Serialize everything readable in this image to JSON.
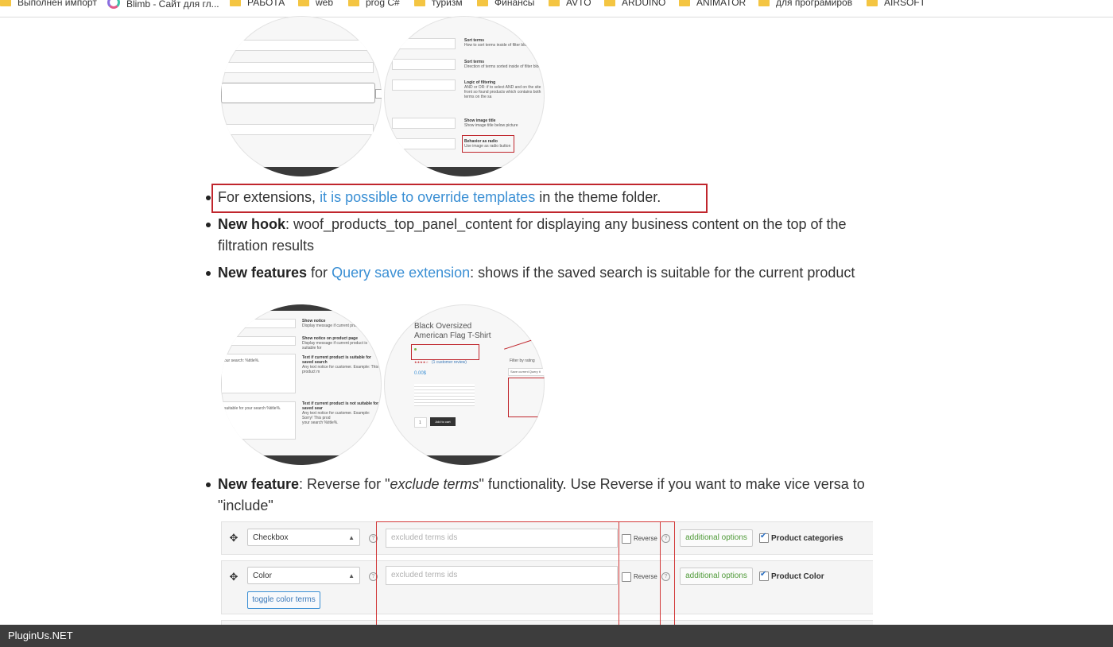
{
  "bookmarks": [
    {
      "label": "Выполнен импорт",
      "icon": "folder-icon"
    },
    {
      "label": "Blimb - Сайт для гл...",
      "icon": "blimb-logo-icon"
    },
    {
      "label": "РАБОТА",
      "icon": "folder-icon"
    },
    {
      "label": "web",
      "icon": "folder-icon"
    },
    {
      "label": "prog C#",
      "icon": "folder-icon"
    },
    {
      "label": "туризм",
      "icon": "folder-icon"
    },
    {
      "label": "Финансы",
      "icon": "folder-icon"
    },
    {
      "label": "AVTO",
      "icon": "folder-icon"
    },
    {
      "label": "ARDUINO",
      "icon": "folder-icon"
    },
    {
      "label": "ANIMATOR",
      "icon": "folder-icon"
    },
    {
      "label": "для програмиров",
      "icon": "folder-icon"
    },
    {
      "label": "AIRSOFT",
      "icon": "folder-icon"
    }
  ],
  "screenshot1": {
    "right": {
      "sort_terms_title": "Sort terms",
      "sort_terms_desc": "How to sort terms inside of filter block",
      "sort_terms2_title": "Sort terms",
      "sort_terms2_desc": "Direction of terms sorted inside of filter block",
      "logic_title": "Logic of filtering",
      "logic_desc": "AND or OR: if to select AND and on the site front so found products which contains both terms on the sa",
      "show_image_title": "Show image title",
      "show_image_desc": "Show image title below picture",
      "behavior_title": "Behavior as radio",
      "behavior_desc": "Use image as radio button"
    }
  },
  "list": {
    "item1": {
      "prefix": "For extensions, ",
      "link": "it is possible to override templates",
      "suffix": " in the theme folder."
    },
    "item2": {
      "bold": "New hook",
      "text": ": woof_products_top_panel_content for displaying any business content on the top of the filtration results"
    },
    "item3": {
      "bold": "New features",
      "mid": " for ",
      "link": "Query save extension",
      "text": ": shows if the saved search is suitable for the current product"
    },
    "item4": {
      "bold": "New feature",
      "text1": ": Reverse for \"",
      "italic": "exclude terms",
      "text2": "\" functionality. Use Reverse if you want to make vice versa to \"include\""
    }
  },
  "screenshot2": {
    "left": {
      "show_notice": "Show notice",
      "show_notice_desc": "Display message if current product is",
      "show_notice_page": "Show notice on product page",
      "show_notice_page_desc": "Display message if current product is suitable for",
      "text_suitable": "Text if current product is suitable for saved search",
      "text_suitable_desc": "Any text notice for customer. Example: This product m",
      "search_hint_1": "our search: %title%.",
      "text_not_suitable": "Text if current product is not suitable for saved sear",
      "text_not_suitable_desc": "Any text notice for customer. Example: Sorry! This prod",
      "search_hint_2": "suitable for your search %title%.",
      "search_hint_3": "your search %title%."
    },
    "right": {
      "product_title": "Black Oversized American Flag T-Shirt",
      "price": "0.00$",
      "add_to_cart": "Add to cart",
      "qty": "1",
      "reviews": "(1 customer review)",
      "filter_by_rating": "Filter by rating",
      "save_query": "Save current Query it"
    }
  },
  "woof_rows": [
    {
      "type": "Checkbox",
      "excluded_placeholder": "excluded terms ids",
      "reverse_label": "Reverse",
      "additional_options": "additional options",
      "category": "Product categories",
      "checked": true
    },
    {
      "type": "Color",
      "excluded_placeholder": "excluded terms ids",
      "reverse_label": "Reverse",
      "additional_options": "additional options",
      "category": "Product Color",
      "checked": true,
      "toggle_label": "toggle color terms"
    }
  ],
  "statusbar": {
    "text": "PluginUs.NET"
  },
  "colors": {
    "link": "#3a8fd4",
    "highlight_red": "#c0262d",
    "status_bg": "#3d3d3d",
    "options_green": "#4f9a38"
  }
}
